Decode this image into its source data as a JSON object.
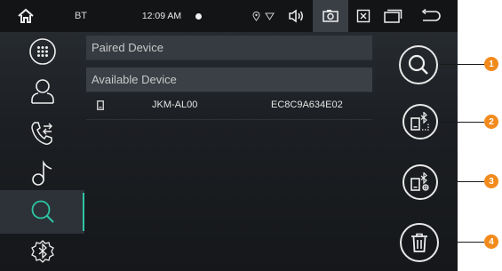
{
  "statusbar": {
    "bt_label": "BT",
    "time": "12:09 AM"
  },
  "nav": {
    "items": [
      "dialpad",
      "contacts",
      "call-log",
      "music",
      "search",
      "bluetooth-settings"
    ],
    "active": "search"
  },
  "list": {
    "paired_header": "Paired Device",
    "available_header": "Available Device",
    "devices": [
      {
        "name": "JKM-AL00",
        "address": "EC8C9A634E02"
      }
    ]
  },
  "actions": [
    "search",
    "connect",
    "disconnect",
    "delete"
  ],
  "callouts": [
    "1",
    "2",
    "3",
    "4"
  ],
  "colors": {
    "accent": "#2ec4a6",
    "callout": "#f28a1c",
    "background": "#1c1f23"
  }
}
